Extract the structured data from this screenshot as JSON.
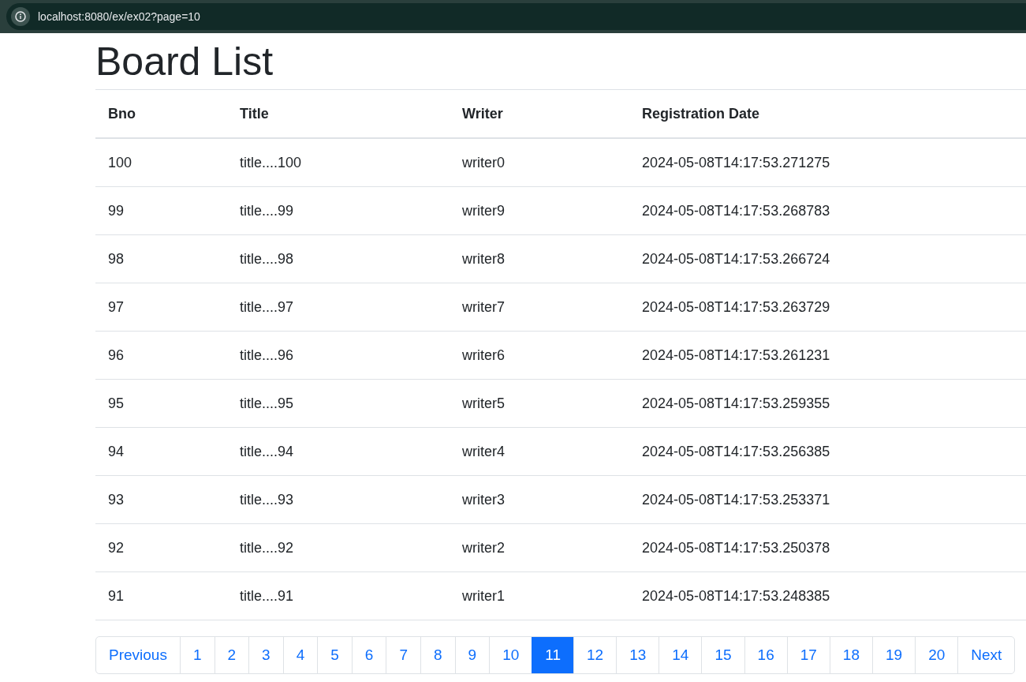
{
  "browser": {
    "url": "localhost:8080/ex/ex02?page=10"
  },
  "page_title": "Board List",
  "table": {
    "columns": [
      "Bno",
      "Title",
      "Writer",
      "Registration Date"
    ],
    "rows": [
      [
        "100",
        "title....100",
        "writer0",
        "2024-05-08T14:17:53.271275"
      ],
      [
        "99",
        "title....99",
        "writer9",
        "2024-05-08T14:17:53.268783"
      ],
      [
        "98",
        "title....98",
        "writer8",
        "2024-05-08T14:17:53.266724"
      ],
      [
        "97",
        "title....97",
        "writer7",
        "2024-05-08T14:17:53.263729"
      ],
      [
        "96",
        "title....96",
        "writer6",
        "2024-05-08T14:17:53.261231"
      ],
      [
        "95",
        "title....95",
        "writer5",
        "2024-05-08T14:17:53.259355"
      ],
      [
        "94",
        "title....94",
        "writer4",
        "2024-05-08T14:17:53.256385"
      ],
      [
        "93",
        "title....93",
        "writer3",
        "2024-05-08T14:17:53.253371"
      ],
      [
        "92",
        "title....92",
        "writer2",
        "2024-05-08T14:17:53.250378"
      ],
      [
        "91",
        "title....91",
        "writer1",
        "2024-05-08T14:17:53.248385"
      ]
    ]
  },
  "pagination": {
    "previous": "Previous",
    "next": "Next",
    "pages": [
      {
        "label": "1",
        "selected": false
      },
      {
        "label": "2",
        "selected": false
      },
      {
        "label": "3",
        "selected": false
      },
      {
        "label": "4",
        "selected": false
      },
      {
        "label": "5",
        "selected": false
      },
      {
        "label": "6",
        "selected": false
      },
      {
        "label": "7",
        "selected": false
      },
      {
        "label": "8",
        "selected": false
      },
      {
        "label": "9",
        "selected": false
      },
      {
        "label": "10",
        "selected": false
      },
      {
        "label": "11",
        "selected": true
      },
      {
        "label": "12",
        "selected": false
      },
      {
        "label": "13",
        "selected": false
      },
      {
        "label": "14",
        "selected": false
      },
      {
        "label": "15",
        "selected": false
      },
      {
        "label": "16",
        "selected": false
      },
      {
        "label": "17",
        "selected": false
      },
      {
        "label": "18",
        "selected": false
      },
      {
        "label": "19",
        "selected": false
      },
      {
        "label": "20",
        "selected": false
      }
    ]
  }
}
